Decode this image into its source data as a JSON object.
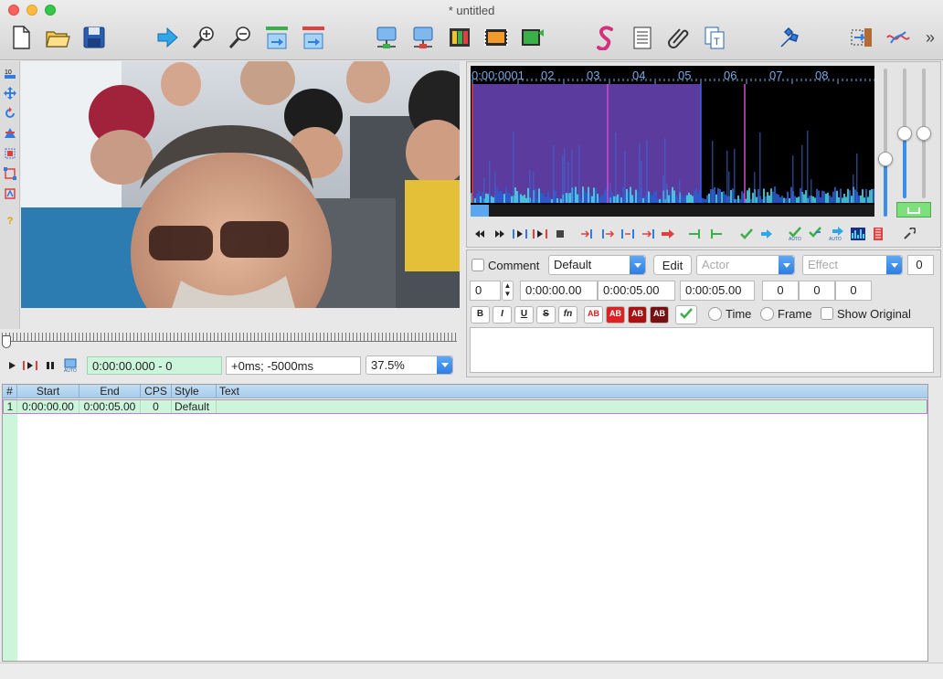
{
  "window": {
    "title": "* untitled"
  },
  "toolbar": {
    "icons": [
      "new-file-icon",
      "open-folder-icon",
      "save-icon",
      "jump-to-icon",
      "zoom-in-icon",
      "zoom-out-icon",
      "snap-start-icon",
      "snap-end-icon",
      "video-select-icon",
      "video-select-end-icon",
      "keyframes-icon",
      "video-details-icon",
      "timecodes-icon",
      "styles-manager-icon",
      "properties-icon",
      "attachments-icon",
      "translation-icon",
      "automation-icon",
      "resample-icon",
      "spell-check-icon",
      "overflow-chevron-icon"
    ]
  },
  "video": {
    "time_display": "0:00:00.000 - 0",
    "offset_display": "+0ms; -5000ms",
    "zoom": "37.5%",
    "seek_position": 0
  },
  "audio": {
    "time_label": "0:00:0001",
    "ruler_marks": [
      "02",
      "03",
      "04",
      "05",
      "06",
      "07",
      "08"
    ],
    "selection": {
      "start_s": 0.0,
      "end_s": 5.0
    },
    "volume_level": 0.35,
    "zoom_level": 0.5,
    "vertical_zoom_level": 0.5
  },
  "editor": {
    "comment_label": "Comment",
    "comment_checked": false,
    "style": "Default",
    "edit_label": "Edit",
    "actor_placeholder": "Actor",
    "effect_placeholder": "Effect",
    "layer_right": "0",
    "layer": "0",
    "start_time": "0:00:00.00",
    "end_time": "0:00:05.00",
    "duration": "0:00:05.00",
    "margin_l": "0",
    "margin_r": "0",
    "margin_v": "0",
    "format_buttons": [
      "B",
      "I",
      "U",
      "S",
      "fn"
    ],
    "color_buttons": [
      "AB",
      "AB",
      "AB",
      "AB"
    ],
    "time_label": "Time",
    "frame_label": "Frame",
    "show_original_label": "Show Original",
    "text": ""
  },
  "grid": {
    "columns": [
      "#",
      "Start",
      "End",
      "CPS",
      "Style",
      "Text"
    ],
    "rows": [
      {
        "num": "1",
        "start": "0:00:00.00",
        "end": "0:00:05.00",
        "cps": "0",
        "style": "Default",
        "text": ""
      }
    ]
  },
  "colors": {
    "accent_blue": "#2f7de0",
    "active_green": "#ccf5dc",
    "selection_purple": "#5b3b9e",
    "spectrum_cyan": "#4ad7e6"
  }
}
